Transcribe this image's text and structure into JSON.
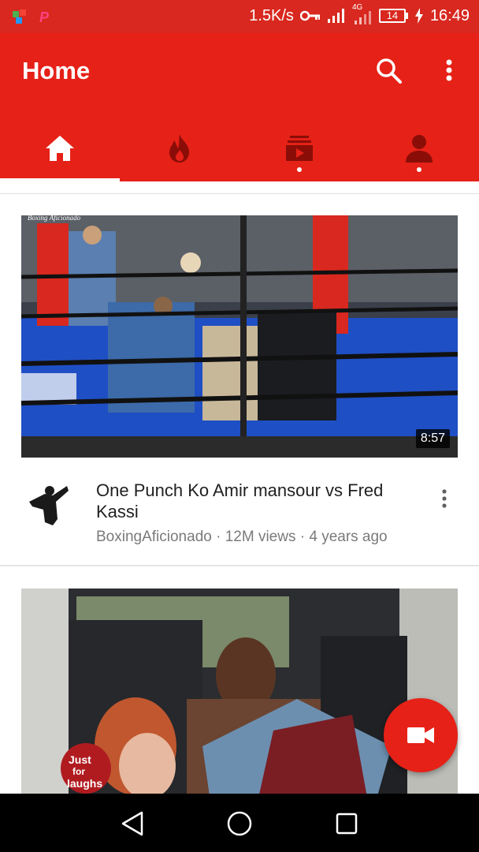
{
  "status_bar": {
    "network_speed": "1.5K/s",
    "network_type": "4G",
    "battery": "14",
    "time": "16:49",
    "icons": [
      "app-notification-icon",
      "p-notification-icon",
      "vpn-key-icon",
      "signal-icon",
      "signal-4g-icon",
      "battery-icon",
      "charging-icon"
    ]
  },
  "app_bar": {
    "title": "Home",
    "actions": [
      "search-icon",
      "more-vert-icon"
    ],
    "accent": "#e62117"
  },
  "tabs": [
    {
      "icon": "home-icon",
      "selected": true,
      "has_dot": false
    },
    {
      "icon": "trending-fire-icon",
      "selected": false,
      "has_dot": false
    },
    {
      "icon": "subscriptions-icon",
      "selected": false,
      "has_dot": true
    },
    {
      "icon": "account-icon",
      "selected": false,
      "has_dot": true
    }
  ],
  "feed": {
    "videos": [
      {
        "thumbnail": "boxing-ring-thumbnail",
        "duration": "8:57",
        "title": "One Punch Ko Amir mansour vs Fred Kassi",
        "channel": "BoxingAficionado",
        "views": "12M views",
        "age": "4 years ago",
        "meta": "BoxingAficionado · 12M views · 4 years ago"
      },
      {
        "thumbnail": "just-for-laughs-van-thumbnail"
      }
    ]
  },
  "fab": {
    "icon": "videocam-icon"
  },
  "nav_bar": {
    "icons": [
      "back-icon",
      "home-circle-icon",
      "recents-icon"
    ]
  }
}
